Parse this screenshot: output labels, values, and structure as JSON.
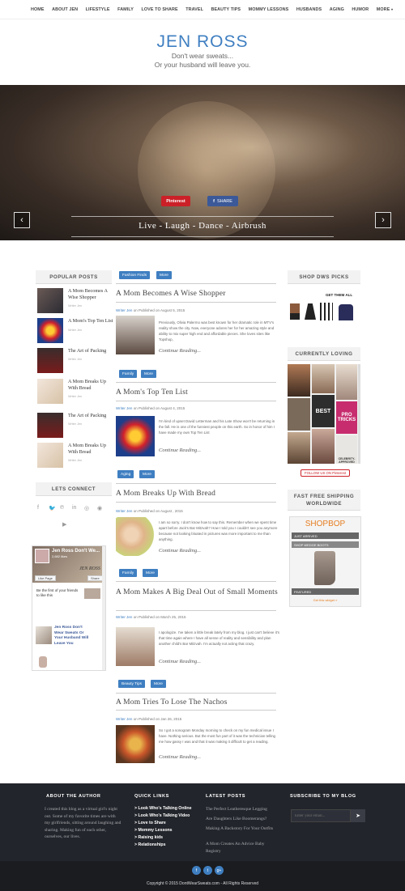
{
  "nav": [
    "HOME",
    "ABOUT JEN",
    "LIFESTYLE",
    "FAMILY",
    "LOVE TO SHARE",
    "TRAVEL",
    "BEAUTY TIPS",
    "MOMMY LESSONS",
    "HUSBANDS",
    "AGING",
    "HUMOR",
    "MORE"
  ],
  "brand": {
    "title": "JEN ROSS",
    "tagline1": "Don't wear sweats...",
    "tagline2": "Or your husband will leave you."
  },
  "hero": {
    "caption": "Live - Laugh - Dance - Airbrush",
    "pinterest": "Pinterest",
    "share": "SHARE",
    "prev": "‹",
    "next": "›"
  },
  "sidebar_left": {
    "popular_title": "POPULAR POSTS",
    "posts": [
      {
        "title": "A Mom Becomes A Wise Shopper",
        "by": "Writer Jen"
      },
      {
        "title": "A Mom's Top Ten List",
        "by": "Writer Jen"
      },
      {
        "title": "The Art of Packing",
        "by": "Writer Jen"
      },
      {
        "title": "A Mom Breaks Up With Bread",
        "by": "Writer Jen"
      },
      {
        "title": "The Art of Packing",
        "by": "Writer Jen"
      },
      {
        "title": "A Mom Breaks Up With Bread",
        "by": "Writer Jen"
      }
    ],
    "connect_title": "LETS CONNECT",
    "fb_widget": {
      "page": "Jen Ross Don't We...",
      "likes": "2,682 likes",
      "like_label": "Like Page",
      "share_label": "Share",
      "friends": "Be the first of your friends to like this",
      "post_title": "Jen Ross Don't Wear Sweats Or Your Husband Will Leave You",
      "logo": "JEN ROSS"
    }
  },
  "posts": [
    {
      "tags": [
        "Fashion Finds",
        "More"
      ],
      "title": "A Mom Becomes A Wise Shopper",
      "meta_writer": "Writer Jen",
      "meta_date": "on Published on August 5, 2015",
      "excerpt": "Previously, Olivia Palermo was best known for her dramatic role in MTV's reality show the city. Now, everyone adores her for her amazing style and ability to mix super high end and affordable pieces. She loves sites like Topshop,",
      "continue": "Continue Reading..."
    },
    {
      "tags": [
        "Family",
        "More"
      ],
      "title": "A Mom's Top Ten List",
      "meta_writer": "Writer Jen",
      "meta_date": "on Published on August 4, 2015",
      "excerpt": "I'm kind of upset David Letterman and his Late Show won't be returning in the fall. He is one of the funniest people on this earth. So in honor of him I have made my own Top Ten List",
      "continue": "Continue Reading..."
    },
    {
      "tags": [
        "Aging",
        "More"
      ],
      "title": "A Mom Breaks Up With Bread",
      "meta_writer": "Writer Jen",
      "meta_date": "on Published on August , 2015",
      "excerpt": "I am so sorry. I don't know how to say this. Remember when we spent time apart before Jack's Bar Mitzvah? How I told you I couldn't see you anymore because not looking bloated in pictures was more important to me than anything.",
      "continue": "Continue Reading..."
    },
    {
      "tags": [
        "Family",
        "More"
      ],
      "title": "A Mom Makes A Big Deal Out of Small Moments",
      "meta_writer": "Writer Jen",
      "meta_date": "on Published on March 25, 2015",
      "excerpt": "I apologize. I've taken a little break lately from my blog. I just can't believe it's that time again where I have all sense of reality and sensibility and plan another child's Bar Mitzvah. I'm actually not acting that crazy.",
      "continue": "Continue Reading..."
    },
    {
      "tags": [
        "Beauty Tips",
        "More"
      ],
      "title": "A Mom Tries To Lose The Nachos",
      "meta_writer": "Writer Jen",
      "meta_date": "on Published on Jan 26, 2015",
      "excerpt": "So I got a sonogram Monday morning to check on my fun medical issue I have. Nothing serious. But the most fun part of it was the technician telling me how gassy I was and that it was making it difficult to get a reading.",
      "continue": "Continue Reading..."
    }
  ],
  "sidebar_right": {
    "shop_title": "SHOP DWS PICKS",
    "get_look": "GET THEM ALL",
    "loving_title": "CURRENTLY LOVING",
    "follow": "FOLLOW US ON Pinterest",
    "pin_tiles": [
      "BEST",
      "PRO TRICKS",
      "CELEBRITY-APPROVED"
    ],
    "shipping_title": "FAST FREE SHIPPING WORLDWIDE",
    "shopbop": {
      "logo": "SHOPBOP",
      "bar1": "JUST ARRIVED",
      "bar2": "SHOP WEDGE BOOTS",
      "bar3": "FEATURED",
      "link": "Get this widget »"
    }
  },
  "footer": {
    "about_title": "ABOUT THE AUTHOR",
    "about_text": "I created this blog as a virtual girl's night out. Some of my favorite times are with my girlfriends, sitting around laughing and sharing. Making fun of each other, ourselves, our lives.",
    "links_title": "QUICK LINKS",
    "links": [
      "> Look Who's Talking Online",
      "> Look Who's Talking Video",
      "> Love to Share",
      "> Mommy Lessons",
      "> Raising kids",
      "> Relationships"
    ],
    "latest_title": "LATEST POSTS",
    "latest": [
      "The Perfect Leatheresque Legging",
      "Are Daughters Like Boomerangs?",
      "Making A Backstory For Your Outfits",
      "A Mom Creates An Advice Baby Registry"
    ],
    "subscribe_title": "SUBSCRIBE TO MY BLOG",
    "email_placeholder": "Enter your email...",
    "copyright": "Copyright © 2015 DontWearSweats.com - All Rights Reserved"
  }
}
